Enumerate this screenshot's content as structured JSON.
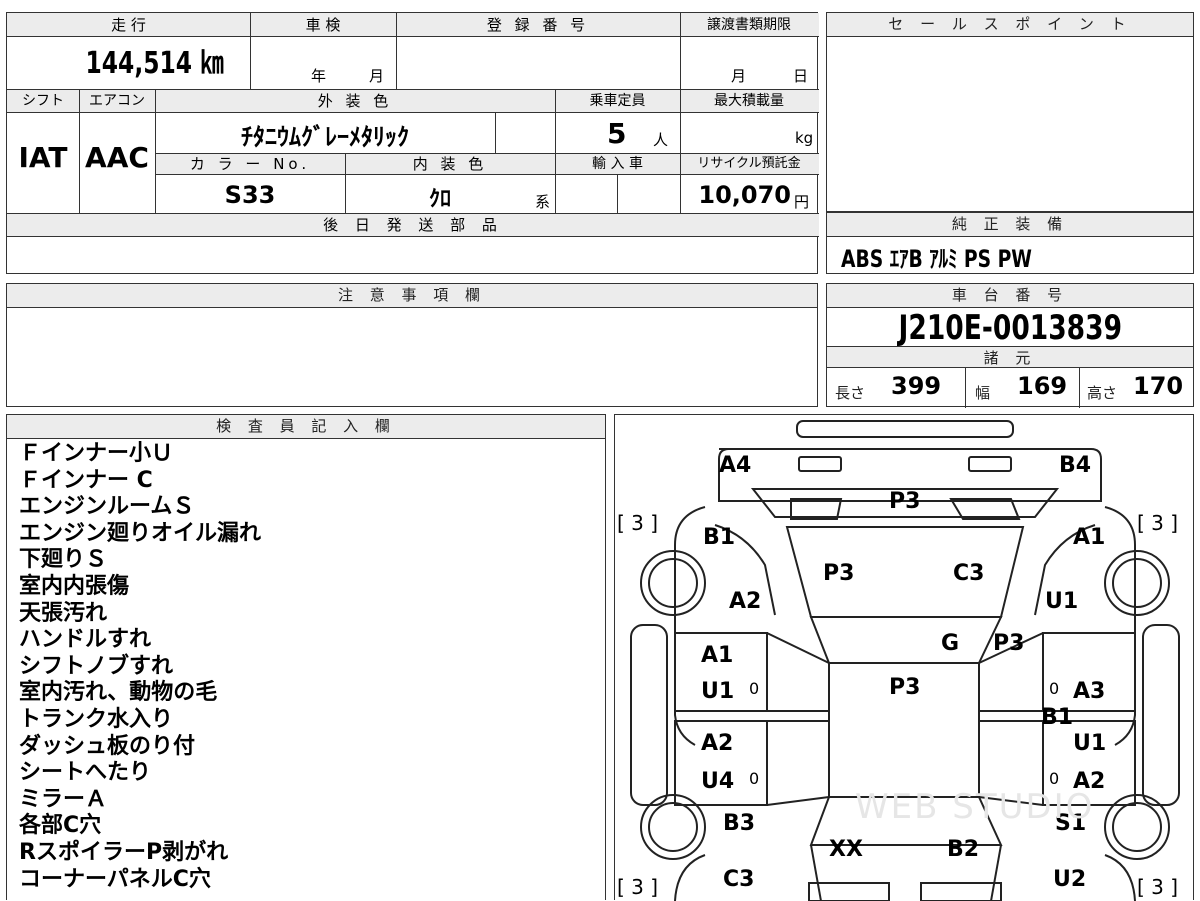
{
  "top": {
    "mileage_label": "走 行",
    "mileage_value": "144,514 ㎞",
    "inspection_label": "車 検",
    "inspection_year": "年",
    "inspection_month": "月",
    "registration_label": "登 録 番 号",
    "transfer_label": "譲渡書類期限",
    "transfer_month": "月",
    "transfer_day": "日",
    "shift_label": "シフト",
    "shift_value": "IAT",
    "aircon_label": "エアコン",
    "aircon_value": "AAC",
    "exterior_label": "外 装 色",
    "exterior_value": "ﾁﾀﾆｳﾑｸﾞﾚｰﾒﾀﾘｯｸ",
    "capacity_label": "乗車定員",
    "capacity_value": "5",
    "capacity_unit": "人",
    "maxload_label": "最大積載量",
    "maxload_unit": "kg",
    "color_no_label": "カ ラ ー No.",
    "color_no_value": "S33",
    "interior_label": "内 装 色",
    "interior_value": "ｸﾛ",
    "interior_unit": "系",
    "import_label": "輸 入 車",
    "recycle_label": "リサイクル預託金",
    "recycle_value": "10,070",
    "recycle_unit": "円",
    "later_parts_label": "後 日 発 送 部 品"
  },
  "sales": {
    "label": "セ ー ル ス ポ イ ン ト"
  },
  "equipment": {
    "label": "純 正 装 備",
    "value": "ABS ｴｱB ｱﾙﾐ PS PW"
  },
  "notes": {
    "label": "注 意 事 項 欄"
  },
  "chassis": {
    "label": "車 台 番 号",
    "value": "J210E-0013839",
    "spec_label": "諸 元",
    "length_label": "長さ",
    "length_value": "399",
    "width_label": "幅",
    "width_value": "169",
    "height_label": "高さ",
    "height_value": "170"
  },
  "inspector": {
    "label": "検 査 員 記 入 欄",
    "lines": [
      "Ｆインナー小Ｕ",
      "Ｆインナー C",
      "エンジンルームＳ",
      "エンジン廻りオイル漏れ",
      "下廻りＳ",
      "室内内張傷",
      "天張汚れ",
      "ハンドルすれ",
      "シフトノブすれ",
      "室内汚れ、動物の毛",
      "トランク水入り",
      "ダッシュ板のり付",
      "シートへたり",
      "ミラーＡ",
      "各部C穴",
      "RスポイラーP剥がれ",
      "コーナーパネルC穴"
    ]
  },
  "diagram": {
    "labels": {
      "a4": "A4",
      "b4": "B4",
      "p3_front": "P3",
      "tyre_fl": "[ 3 ]",
      "tyre_fr": "[ 3 ]",
      "tyre_rl": "[ 3 ]",
      "tyre_rr": "[ 3 ]",
      "b1_left": "B1",
      "a1_right": "A1",
      "p3_hood": "P3",
      "c3_hood": "C3",
      "a2_left": "A2",
      "u1_right": "U1",
      "g": "G",
      "p3_right": "P3",
      "a1_door": "A1",
      "u1_door": "U1",
      "p3_roof": "P3",
      "a3_door": "A3",
      "b1_door": "B1",
      "a2_rdoor": "A2",
      "u1_rdoor": "U1",
      "u4_rdoor": "U4",
      "a2_rdoor_r": "A2",
      "b3": "B3",
      "s1": "S1",
      "xx": "XX",
      "b2": "B2",
      "c3_rear": "C3",
      "u2": "U2",
      "zero1": "0",
      "zero2": "0",
      "zero3": "0",
      "zero4": "0",
      "watermark": "WEB STUDIO"
    }
  }
}
